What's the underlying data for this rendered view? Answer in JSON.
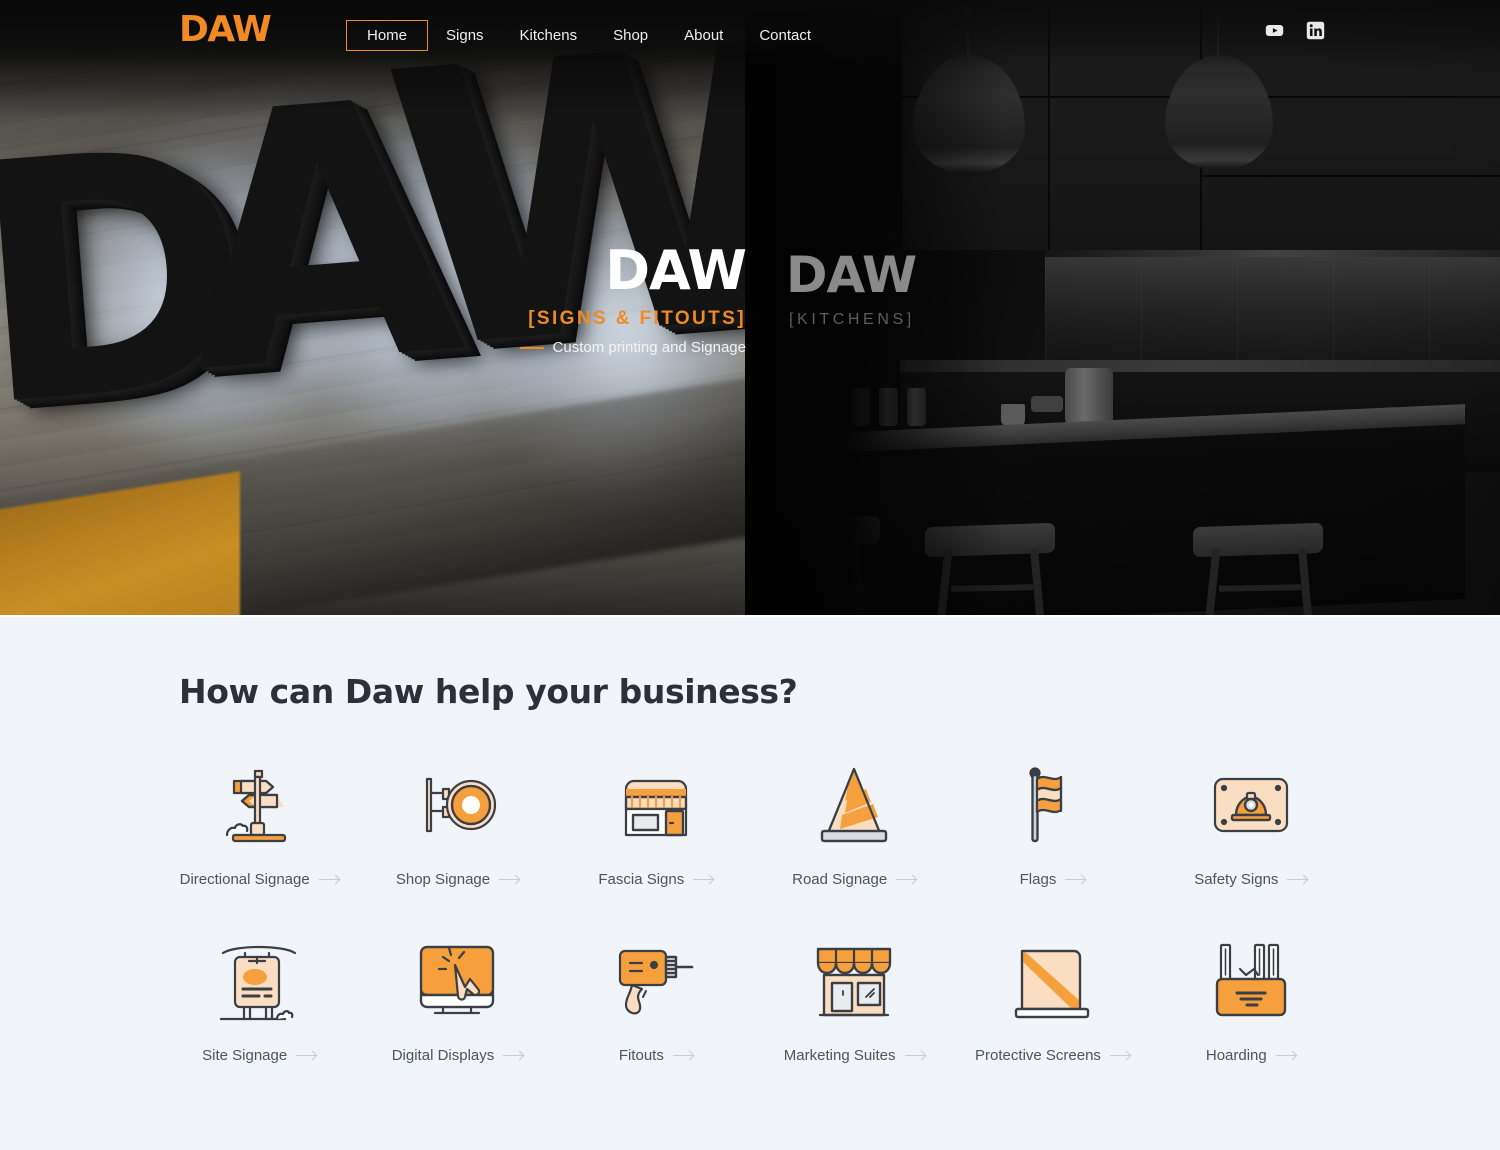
{
  "header": {
    "logo": "DAW",
    "nav": [
      {
        "label": "Home",
        "active": true
      },
      {
        "label": "Signs",
        "active": false
      },
      {
        "label": "Kitchens",
        "active": false
      },
      {
        "label": "Shop",
        "active": false
      },
      {
        "label": "About",
        "active": false
      },
      {
        "label": "Contact",
        "active": false
      }
    ],
    "socials": [
      {
        "name": "youtube-icon"
      },
      {
        "name": "linkedin-icon"
      }
    ]
  },
  "hero": {
    "left": {
      "brand": "DAW",
      "tagline": "[SIGNS & FITOUTS]",
      "subtitle": "Custom printing and Signage"
    },
    "right": {
      "brand": "DAW",
      "tagline": "[KITCHENS]"
    }
  },
  "services": {
    "title": "How can Daw help your business?",
    "items": [
      {
        "label": "Directional Signage",
        "icon": "directional-signage-icon"
      },
      {
        "label": "Shop Signage",
        "icon": "shop-signage-icon"
      },
      {
        "label": "Fascia Signs",
        "icon": "fascia-signs-icon"
      },
      {
        "label": "Road Signage",
        "icon": "road-signage-icon"
      },
      {
        "label": "Flags",
        "icon": "flags-icon"
      },
      {
        "label": "Safety Signs",
        "icon": "safety-signs-icon"
      },
      {
        "label": "Site Signage",
        "icon": "site-signage-icon"
      },
      {
        "label": "Digital Displays",
        "icon": "digital-displays-icon"
      },
      {
        "label": "Fitouts",
        "icon": "fitouts-icon"
      },
      {
        "label": "Marketing Suites",
        "icon": "marketing-suites-icon"
      },
      {
        "label": "Protective Screens",
        "icon": "protective-screens-icon"
      },
      {
        "label": "Hoarding",
        "icon": "hoarding-icon"
      }
    ]
  },
  "colors": {
    "brand_orange": "#f08a24",
    "icon_orange": "#f5a03c",
    "icon_light": "#fbddc2",
    "icon_outline": "#3a3f46",
    "section_bg": "#f1f4f8",
    "heading": "#2b303a",
    "label": "#4c5560"
  }
}
